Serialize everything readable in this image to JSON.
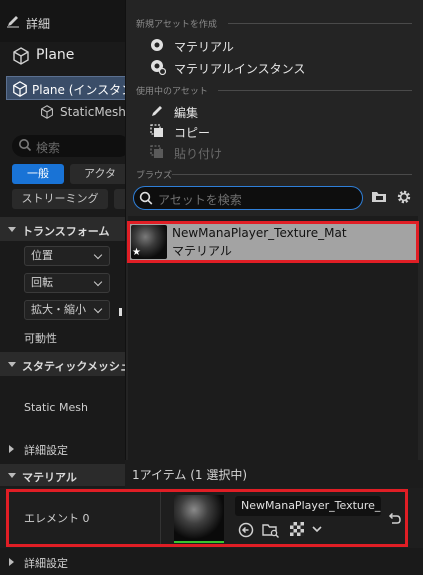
{
  "details": {
    "title": "詳細",
    "object_name": "Plane",
    "tree_selected": "Plane (インスタン",
    "tree_child": "StaticMesh",
    "search_placeholder": "検索",
    "tabs": [
      "一般",
      "アクタ"
    ],
    "streaming_tab": "ストリーミング",
    "sections": {
      "transform": "トランスフォーム",
      "position": "位置",
      "rotation": "回転",
      "scale": "拡大・縮小",
      "mobility": "可動性",
      "static_mesh_section": "スタティックメッシュ",
      "static_mesh_label": "Static Mesh",
      "advanced_1": "詳細設定",
      "materials": "マテリアル",
      "element_label": "エレメント 0",
      "advanced_2": "詳細設定"
    }
  },
  "picker": {
    "create_heading": "新規アセットを作成",
    "create_items": [
      "マテリアル",
      "マテリアルインスタンス"
    ],
    "current_heading": "使用中のアセット",
    "edit": "編集",
    "copy": "コピー",
    "paste": "貼り付け",
    "browse_heading": "ブラウズ",
    "search_placeholder": "アセットを検索",
    "asset": {
      "name": "NewManaPlayer_Texture_Mat",
      "type": "マテリアル"
    },
    "footer": "1アイテム (1 選択中)"
  },
  "element": {
    "combo_value": "NewManaPlayer_Texture_M"
  },
  "colors": {
    "accent": "#1973d6",
    "highlight_border": "#e01e25",
    "selected_row": "#a3a3a3"
  }
}
